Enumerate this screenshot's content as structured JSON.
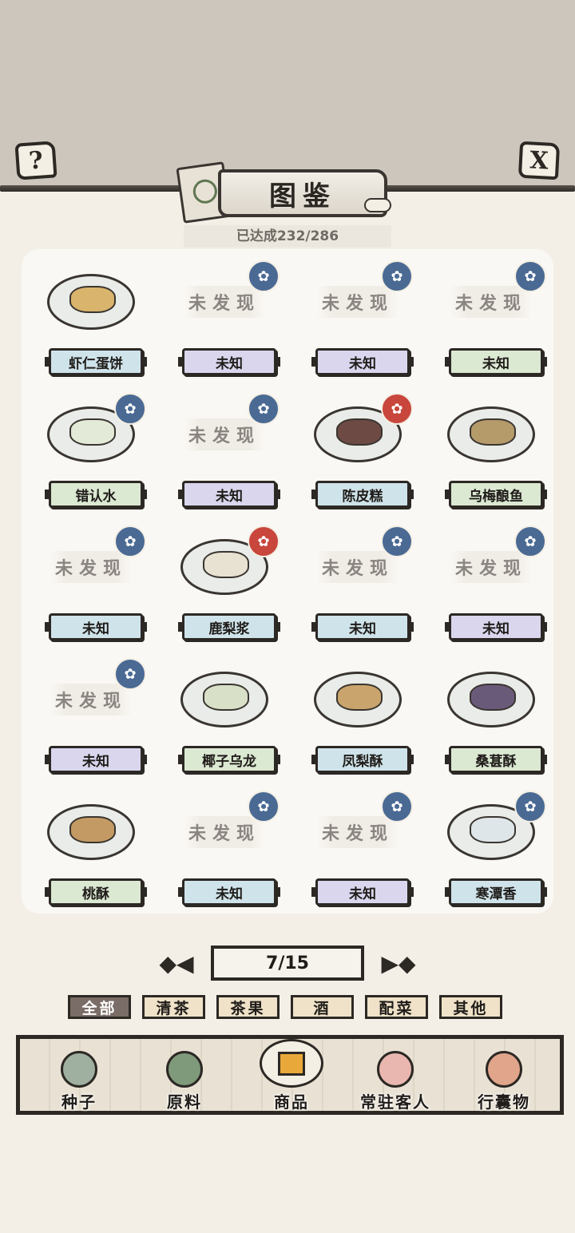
{
  "header": {
    "help_icon_text": "?",
    "close_icon_text": "X",
    "title": "图鉴",
    "progress": "已达成232/286"
  },
  "items": [
    {
      "name": "虾仁蛋饼",
      "discovered": true,
      "art_label": "",
      "badge": "none",
      "plate_color": "#cfe3ea"
    },
    {
      "name": "未知",
      "discovered": false,
      "art_label": "未发现",
      "badge": "blue",
      "plate_color": "#d9d6ee"
    },
    {
      "name": "未知",
      "discovered": false,
      "art_label": "未发现",
      "badge": "blue",
      "plate_color": "#d9d6ee"
    },
    {
      "name": "未知",
      "discovered": false,
      "art_label": "未发现",
      "badge": "blue",
      "plate_color": "#dbe8d2"
    },
    {
      "name": "错认水",
      "discovered": true,
      "art_label": "",
      "badge": "blue",
      "plate_color": "#dbe8d2"
    },
    {
      "name": "未知",
      "discovered": false,
      "art_label": "未发现",
      "badge": "blue",
      "plate_color": "#d9d6ee"
    },
    {
      "name": "陈皮糕",
      "discovered": true,
      "art_label": "",
      "badge": "red",
      "plate_color": "#cfe3ea"
    },
    {
      "name": "乌梅酿鱼",
      "discovered": true,
      "art_label": "",
      "badge": "none",
      "plate_color": "#dbe8d2"
    },
    {
      "name": "未知",
      "discovered": false,
      "art_label": "未发现",
      "badge": "blue",
      "plate_color": "#cfe3ea"
    },
    {
      "name": "鹿梨浆",
      "discovered": true,
      "art_label": "",
      "badge": "red",
      "plate_color": "#cfe3ea"
    },
    {
      "name": "未知",
      "discovered": false,
      "art_label": "未发现",
      "badge": "blue",
      "plate_color": "#cfe3ea"
    },
    {
      "name": "未知",
      "discovered": false,
      "art_label": "未发现",
      "badge": "blue",
      "plate_color": "#d9d6ee"
    },
    {
      "name": "未知",
      "discovered": false,
      "art_label": "未发现",
      "badge": "blue",
      "plate_color": "#d9d6ee"
    },
    {
      "name": "椰子乌龙",
      "discovered": true,
      "art_label": "",
      "badge": "none",
      "plate_color": "#dbe8d2"
    },
    {
      "name": "凤梨酥",
      "discovered": true,
      "art_label": "",
      "badge": "none",
      "plate_color": "#cfe3ea"
    },
    {
      "name": "桑葚酥",
      "discovered": true,
      "art_label": "",
      "badge": "none",
      "plate_color": "#dbe8d2"
    },
    {
      "name": "桃酥",
      "discovered": true,
      "art_label": "",
      "badge": "none",
      "plate_color": "#dbe8d2"
    },
    {
      "name": "未知",
      "discovered": false,
      "art_label": "未发现",
      "badge": "blue",
      "plate_color": "#cfe3ea"
    },
    {
      "name": "未知",
      "discovered": false,
      "art_label": "未发现",
      "badge": "blue",
      "plate_color": "#d9d6ee"
    },
    {
      "name": "寒潭香",
      "discovered": true,
      "art_label": "",
      "badge": "blue",
      "plate_color": "#cfe3ea"
    }
  ],
  "pager": {
    "prev_icon": "◆◀",
    "next_icon": "▶◆",
    "page": "7/15"
  },
  "tabs": [
    {
      "label": "全部",
      "active": true
    },
    {
      "label": "清茶",
      "active": false
    },
    {
      "label": "茶果",
      "active": false
    },
    {
      "label": "酒",
      "active": false
    },
    {
      "label": "配菜",
      "active": false
    },
    {
      "label": "其他",
      "active": false
    }
  ],
  "nav": [
    {
      "label": "种子",
      "icon": "seed-jar-icon",
      "color": "#9fb0a0"
    },
    {
      "label": "原料",
      "icon": "leaf-icon",
      "color": "#7f9a7a"
    },
    {
      "label": "商品",
      "icon": "tofu-icon",
      "color": "#f4efe4"
    },
    {
      "label": "常驻客人",
      "icon": "guest-girl-icon",
      "color": "#e9b7b0"
    },
    {
      "label": "行囊物",
      "icon": "robe-icon",
      "color": "#e0a58a"
    }
  ],
  "colors": {
    "badge_blue": "#4a6a94",
    "badge_red": "#c8463c",
    "active_tab": "#7a6c66",
    "tab_bg": "#efe2c8"
  }
}
